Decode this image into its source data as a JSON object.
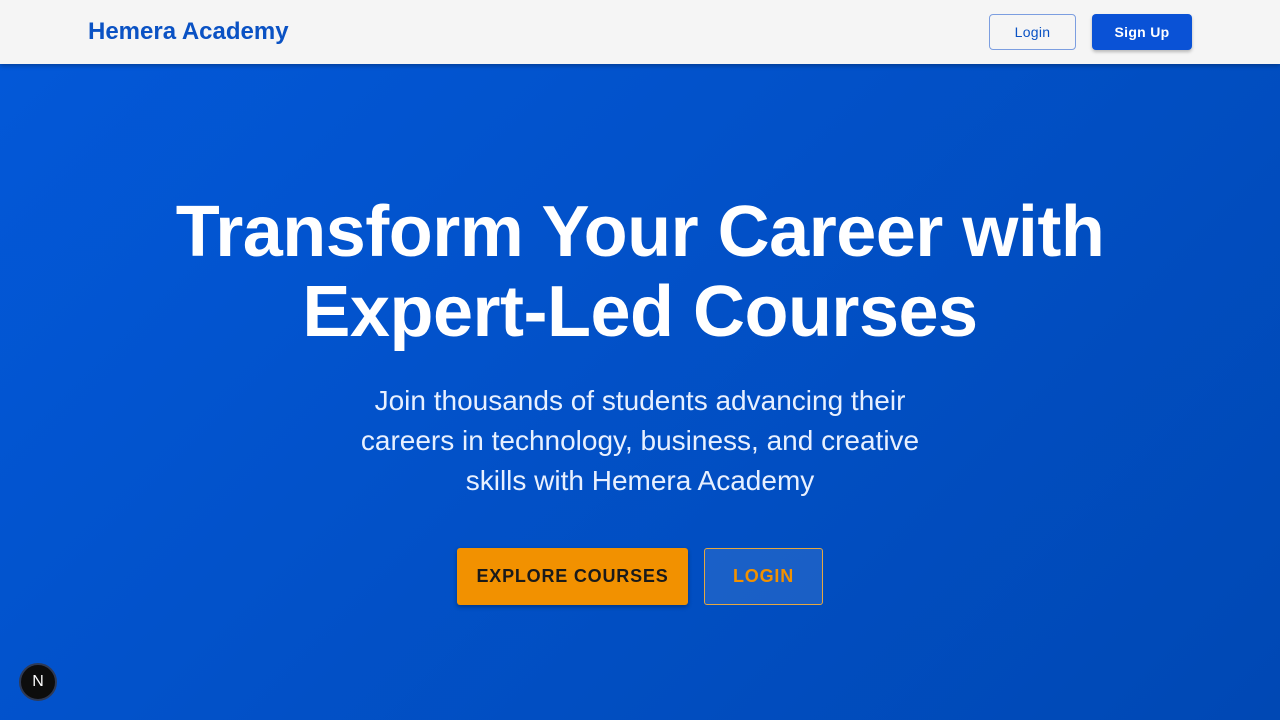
{
  "header": {
    "brand": "Hemera Academy",
    "login_label": "Login",
    "signup_label": "Sign Up"
  },
  "hero": {
    "title": "Transform Your Career with Expert-Led Courses",
    "subtitle": "Join thousands of students advancing their careers in technology, business, and creative skills with Hemera Academy",
    "explore_label": "EXPLORE COURSES",
    "login_label": "LOGIN"
  },
  "dev_badge": {
    "letter": "N",
    "icon": "nextjs-logo-icon"
  },
  "colors": {
    "brand": "#0a52c4",
    "primary": "#0a52d6",
    "hero_start": "#0358d8",
    "hero_end": "#0048b4",
    "accent": "#f29100",
    "header_bg": "#f5f5f5"
  }
}
